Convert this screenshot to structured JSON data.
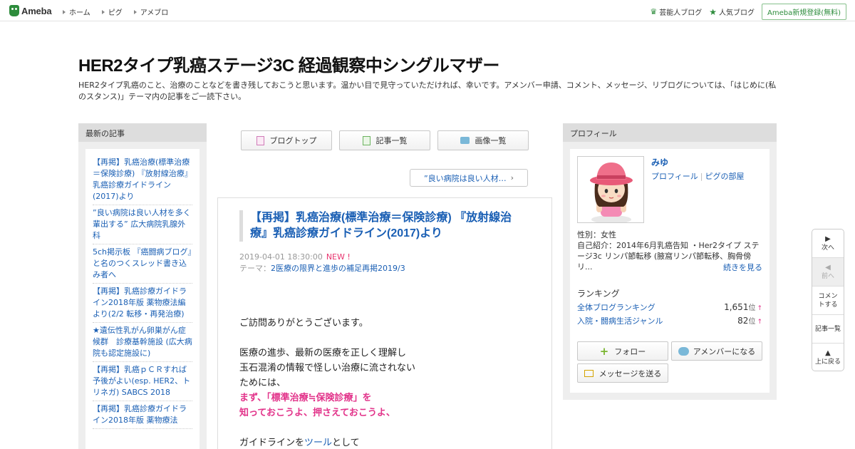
{
  "header": {
    "logo_text": "Ameba",
    "nav": [
      "ホーム",
      "ピグ",
      "アメブロ"
    ],
    "celeb_blog": "芸能人ブログ",
    "popular_blog": "人気ブログ",
    "signup": "Ameba新規登録(無料)"
  },
  "blog": {
    "title": "HER2タイプ乳癌ステージ3C 経過観察中シングルマザー",
    "description": "HER2タイプ乳癌のこと、治療のことなどを書き残しておこうと思います。温かい目で見守っていただければ、幸いです。アメンバー申請、コメント、メッセージ、リブログについては、「はじめに(私のスタンス)」テーマ内の記事をご一読下さい。"
  },
  "left_sidebar": {
    "heading": "最新の記事",
    "items": [
      "【再掲】乳癌治療(標準治療＝保険診療) 『放射線治療』乳癌診療ガイドライン(2017)より",
      "”良い病院は良い人材を多く輩出する” 広大病院乳腺外科",
      "5ch掲示板 『癌闘病ブログ』と名のつくスレッド書き込み者へ",
      "【再掲】乳癌診療ガイドライン2018年版 薬物療法編より(2/2 転移・再発治療)",
      "★遺伝性乳がん卵巣がん症候群　診療基幹施設 (広大病院も認定施設に)",
      "【再掲】乳癌ｐＣＲすれば予後がよい(esp. HER2、トリネガ) SABCS 2018",
      "【再掲】乳癌診療ガイドライン2018年版 薬物療法"
    ]
  },
  "center": {
    "buttons": [
      "ブログトップ",
      "記事一覧",
      "画像一覧"
    ],
    "prev_link": "”良い病院は良い人材…",
    "article": {
      "title": "【再掲】乳癌治療(標準治療＝保険診療) 『放射線治療』乳癌診療ガイドライン(2017)より",
      "date": "2019-04-01 18:30:00",
      "new_label": "NEW !",
      "theme_label": "テーマ：",
      "theme": "2医療の限界と進歩の補足再掲2019/3",
      "line1": "ご訪問ありがとうございます。",
      "line2": "医療の進歩、最新の医療を正しく理解し",
      "line3": "玉石混淆の情報で怪しい治療に流されない",
      "line4": "ためには、",
      "line5": "まず、「標準治療≒保険診療」を",
      "line6": "知っておこうよ、押さえておこうよ、",
      "line7_pre": "ガイドラインを",
      "line7_link": "ツール",
      "line7_post": "として"
    }
  },
  "profile": {
    "heading": "プロフィール",
    "name": "みゆ",
    "link_profile": "プロフィール",
    "link_room": "ピグの部屋",
    "gender": "性別：女性",
    "intro": "自己紹介：2014年6月乳癌告知 ・Her2タイプ ステージ3c リンパ節転移 (腋窩リンパ節転移、胸骨傍リ...",
    "more": "続きを見る",
    "ranking_title": "ランキング",
    "ranking": [
      {
        "label": "全体ブログランキング",
        "value": "1,651",
        "unit": "位",
        "arrow": "↑"
      },
      {
        "label": "入院・闘病生活ジャンル",
        "value": "82",
        "unit": "位",
        "arrow": "↑"
      }
    ],
    "follow": "フォロー",
    "amember": "アメンバーになる",
    "message": "メッセージを送る"
  },
  "float_nav": {
    "next": "次へ",
    "prev": "前へ",
    "comment": "コメントする",
    "list": "記事一覧",
    "top": "上に戻る",
    "next_glyph": "▶",
    "prev_glyph": "◀",
    "top_glyph": "▲"
  },
  "colors": {
    "brand_green": "#2d8c3c",
    "link_blue": "#1a5fb4",
    "highlight_pink": "#e2338a"
  }
}
